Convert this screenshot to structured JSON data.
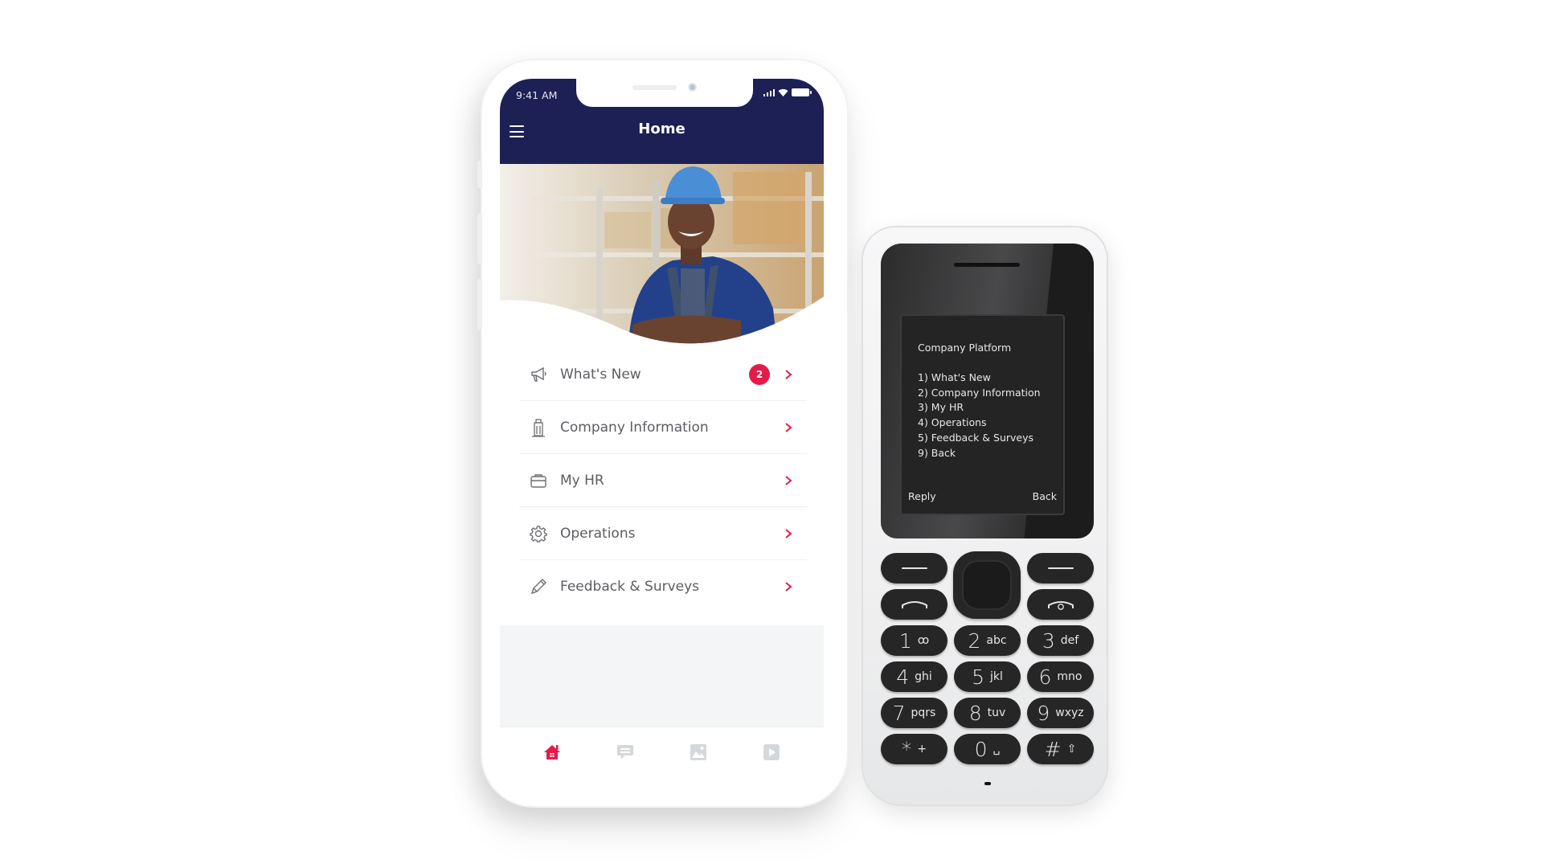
{
  "smartphone": {
    "status_bar": {
      "time": "9:41 AM"
    },
    "app_bar": {
      "title": "Home",
      "menu_icon": "hamburger-icon"
    },
    "hero_image": {
      "description": "Smiling worker in blue hard hat and apron in a lumber warehouse"
    },
    "menu": [
      {
        "label": "What's New",
        "icon": "megaphone-icon",
        "badge": "2"
      },
      {
        "label": "Company Information",
        "icon": "building-icon",
        "badge": null
      },
      {
        "label": "My HR",
        "icon": "briefcase-icon",
        "badge": null
      },
      {
        "label": "Operations",
        "icon": "gear-icon",
        "badge": null
      },
      {
        "label": "Feedback & Surveys",
        "icon": "pencil-icon",
        "badge": null
      }
    ],
    "tab_bar": [
      {
        "name": "home",
        "icon": "home-icon",
        "active": true
      },
      {
        "name": "messages",
        "icon": "chat-icon",
        "active": false
      },
      {
        "name": "gallery",
        "icon": "image-icon",
        "active": false
      },
      {
        "name": "videos",
        "icon": "play-icon",
        "active": false
      }
    ],
    "colors": {
      "primary": "#1d2055",
      "accent": "#e31c4a",
      "text": "#5c5d62",
      "inactive_icon": "#d5d8db"
    }
  },
  "feature_phone": {
    "display": {
      "title": "Company Platform",
      "options": [
        "1) What's New",
        "2) Company Information",
        "3) My HR",
        "4) Operations",
        "5) Feedback & Surveys",
        "9) Back"
      ],
      "soft_left": "Reply",
      "soft_right": "Back"
    },
    "keypad": [
      {
        "num": "1",
        "letters": "ꝏ"
      },
      {
        "num": "2",
        "letters": "abc"
      },
      {
        "num": "3",
        "letters": "def"
      },
      {
        "num": "4",
        "letters": "ghi"
      },
      {
        "num": "5",
        "letters": "jkl"
      },
      {
        "num": "6",
        "letters": "mno"
      },
      {
        "num": "7",
        "letters": "pqrs"
      },
      {
        "num": "8",
        "letters": "tuv"
      },
      {
        "num": "9",
        "letters": "wxyz"
      },
      {
        "num": "*",
        "letters": "+"
      },
      {
        "num": "0",
        "letters": "␣"
      },
      {
        "num": "#",
        "letters": "⇧"
      }
    ]
  }
}
